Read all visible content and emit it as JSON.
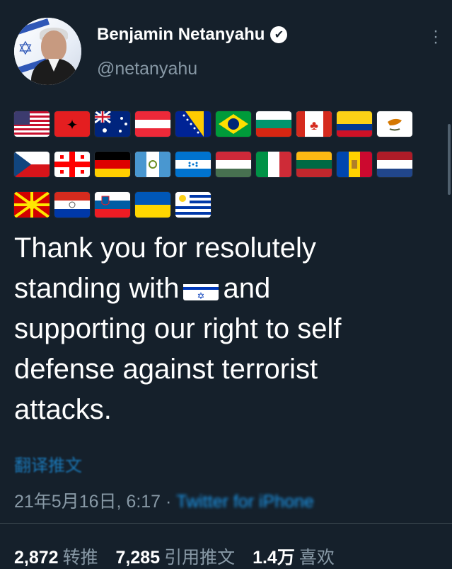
{
  "author": {
    "name": "Benjamin Netanyahu",
    "handle": "@netanyahu",
    "verified_icon": "✔"
  },
  "menu_icon": "more-vertical-icon",
  "flags": {
    "rows": [
      [
        "us",
        "albania",
        "australia",
        "austria",
        "bosnia",
        "brazil",
        "bulgaria",
        "canada",
        "colombia",
        "cyprus"
      ],
      [
        "czech",
        "georgia",
        "germany",
        "guatemala",
        "honduras",
        "hungary",
        "italy",
        "lithuania",
        "moldova",
        "netherlands"
      ],
      [
        "north-macedonia",
        "paraguay",
        "slovenia",
        "ukraine",
        "uruguay"
      ]
    ]
  },
  "tweet": {
    "line1": "Thank you for resolutely",
    "line2_prefix": "standing with",
    "inline_flag": "israel",
    "line2_suffix": "and",
    "line3": "supporting our right to self",
    "line4": "defense against terrorist",
    "line5": "attacks."
  },
  "translate_label": "翻译推文",
  "meta": {
    "date": "21年5月16日, 6:17 · ",
    "source": "Twitter for iPhone"
  },
  "stats": {
    "retweets": "2,872",
    "retweets_label": "转推",
    "quotes": "7,285",
    "quotes_label": "引用推文",
    "likes": "1.4万",
    "likes_label": "喜欢"
  }
}
